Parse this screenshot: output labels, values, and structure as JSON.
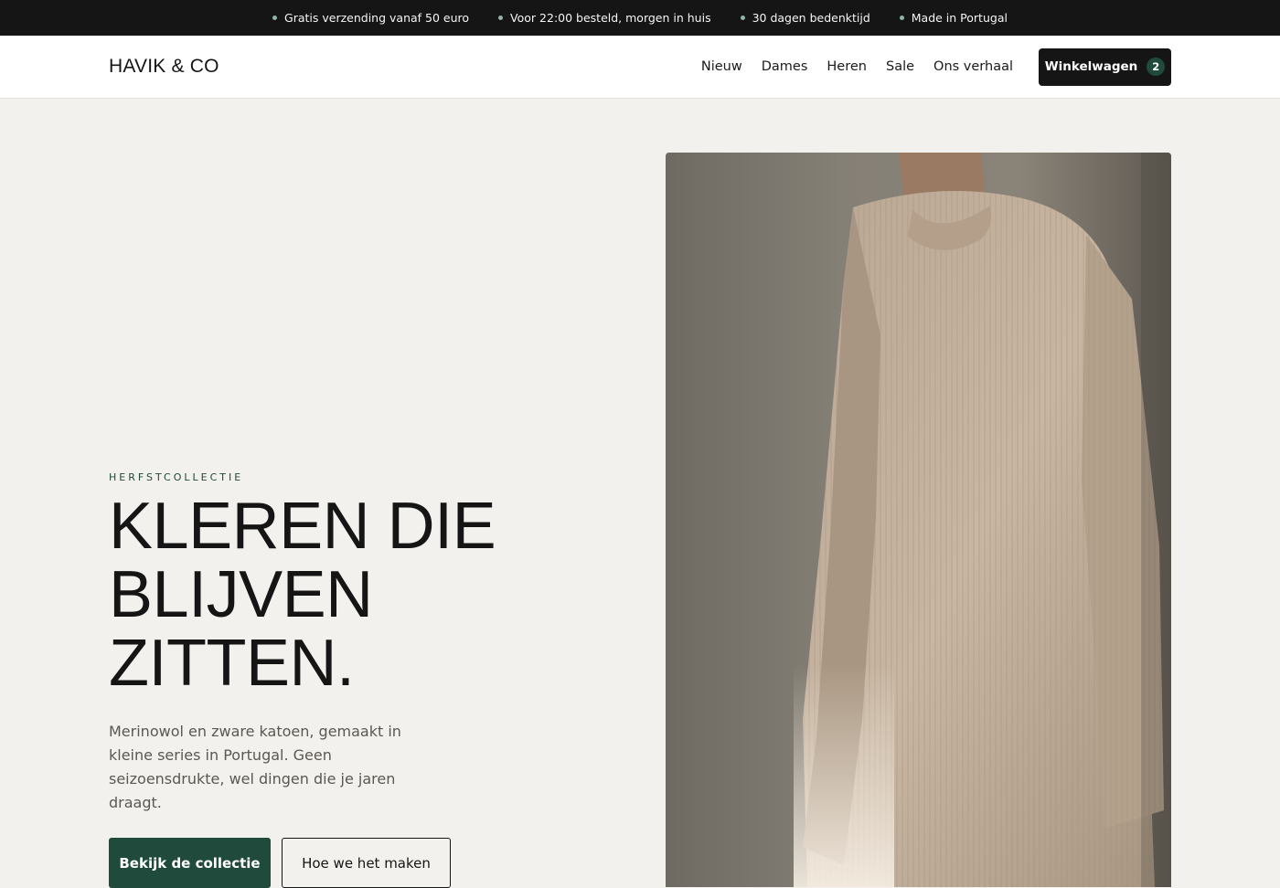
{
  "announcement": {
    "items": [
      "Gratis verzending vanaf 50 euro",
      "Voor 22:00 besteld, morgen in huis",
      "30 dagen bedenktijd",
      "Made in Portugal"
    ],
    "dot_color": "#8fb5a3"
  },
  "header": {
    "logo": "HAVIK & CO",
    "nav": [
      "Nieuw",
      "Dames",
      "Heren",
      "Sale",
      "Ons verhaal"
    ],
    "cart_label": "Winkelwagen",
    "cart_count": "2"
  },
  "hero": {
    "eyebrow": "HERFSTCOLLECTIE",
    "headline": [
      "KLEREN DIE",
      "BLIJVEN",
      "ZITTEN."
    ],
    "intro": "Merinowol en zware katoen, gemaakt in kleine series in Portugal. Geen seizoensdrukte, wel dingen die je jaren draagt.",
    "primary_cta": "Bekijk de collectie",
    "secondary_cta": "Hoe we het maken"
  },
  "colors": {
    "announcement_bg": "#151515",
    "page_bg": "#f3f1ed",
    "accent_green": "#1f4a3c"
  }
}
